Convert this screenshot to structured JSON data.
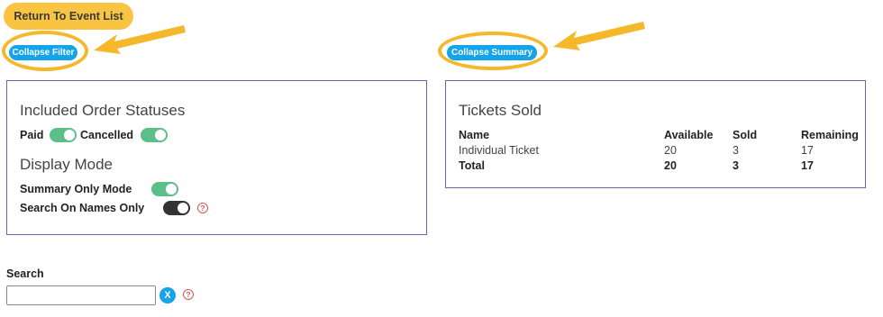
{
  "top": {
    "return_label": "Return To Event List"
  },
  "filter": {
    "collapse_label": "Collapse Filter",
    "statuses_heading": "Included Order Statuses",
    "paid_label": "Paid",
    "paid_on": true,
    "cancelled_label": "Cancelled",
    "cancelled_on": true,
    "display_heading": "Display Mode",
    "summary_only_label": "Summary Only Mode",
    "summary_only_on": true,
    "names_only_label": "Search On Names Only",
    "names_only_on": false,
    "help_glyph": "?"
  },
  "summary": {
    "collapse_label": "Collapse Summary",
    "heading": "Tickets Sold",
    "columns": [
      "Name",
      "Available",
      "Sold",
      "Remaining"
    ],
    "rows": [
      {
        "name": "Individual Ticket",
        "available": "20",
        "sold": "3",
        "remaining": "17"
      }
    ],
    "total": {
      "name": "Total",
      "available": "20",
      "sold": "3",
      "remaining": "17"
    }
  },
  "search": {
    "label": "Search",
    "value": "",
    "placeholder": "",
    "clear_glyph": "X",
    "help_glyph": "?"
  },
  "colors": {
    "highlight": "#f4b82a",
    "accent_blue": "#13a4ea",
    "toggle_on": "#5cbf8a",
    "panel_border": "#7d5ba8"
  }
}
